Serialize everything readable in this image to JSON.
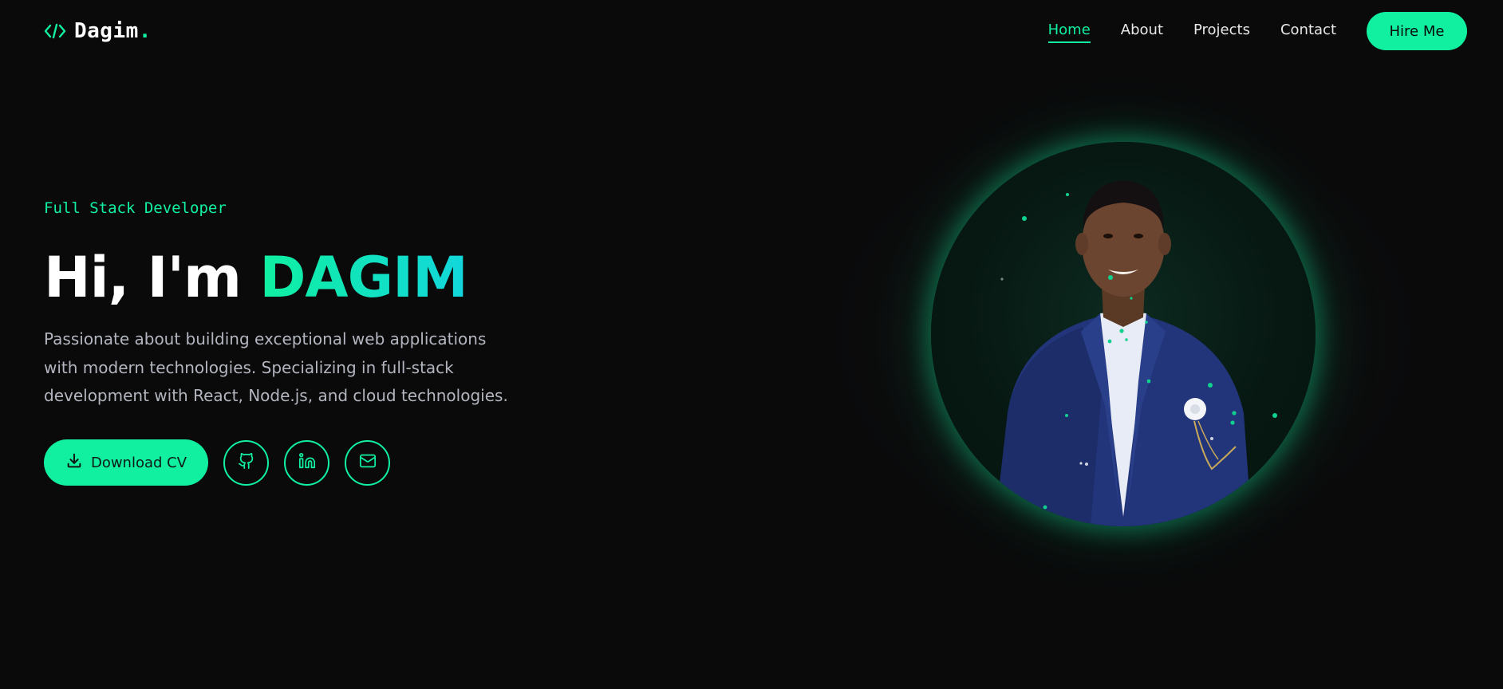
{
  "nav": {
    "logo_name": "Dagim",
    "logo_dot": ".",
    "logo_icon": "code-brackets-icon",
    "links": [
      "Home",
      "About",
      "Projects",
      "Contact"
    ],
    "active_link": "Home",
    "cta": "Hire Me"
  },
  "hero": {
    "subtitle": "Full Stack Developer",
    "greeting": "Hi, I'm ",
    "name": "DAGIM",
    "description": "Passionate about building exceptional web applications with modern technologies. Specializing in full-stack development with React, Node.js, and cloud technologies.",
    "download_label": "Download CV",
    "download_icon": "download-icon",
    "socials": [
      "github-icon",
      "linkedin-icon",
      "mail-icon"
    ]
  },
  "colors": {
    "accent": "#10f0a0",
    "accent_secondary": "#12d6dc",
    "background": "#0a0a0b",
    "text_muted": "#b3b6bf"
  },
  "portrait": {
    "subject": "portrait-photo"
  }
}
